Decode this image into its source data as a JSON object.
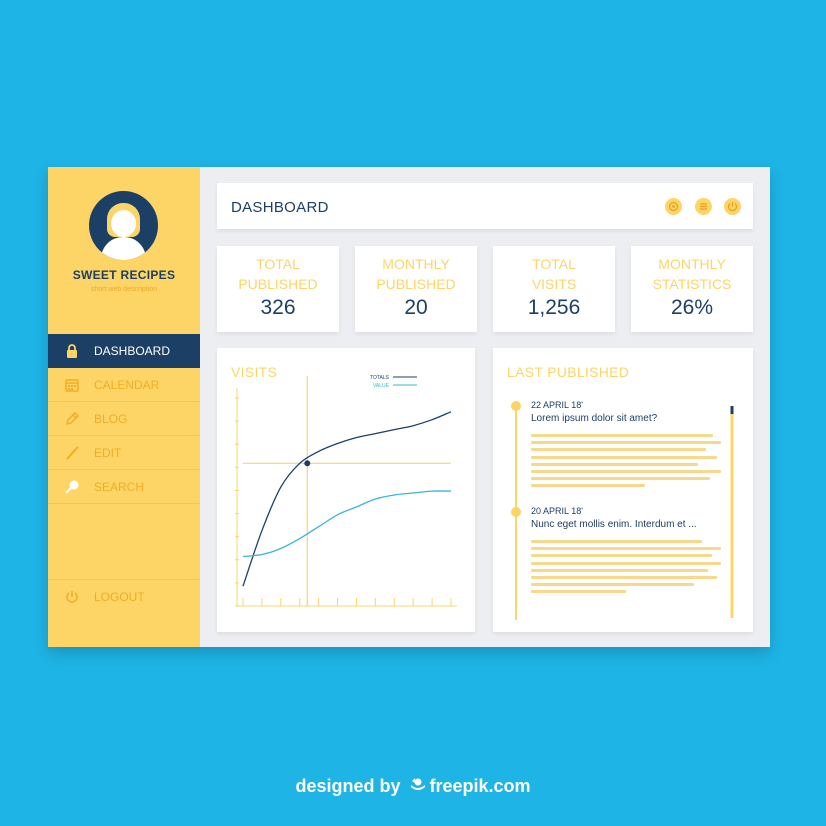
{
  "sidebar": {
    "brand": "SWEET RECIPES",
    "subtitle": "short web description",
    "nav": [
      {
        "label": "DASHBOARD",
        "icon": "lock-icon",
        "active": true
      },
      {
        "label": "CALENDAR",
        "icon": "calendar-icon",
        "active": false
      },
      {
        "label": "BLOG",
        "icon": "pencil-icon",
        "active": false
      },
      {
        "label": "EDIT",
        "icon": "brush-icon",
        "active": false
      },
      {
        "label": "SEARCH",
        "icon": "search-icon",
        "active": false
      }
    ],
    "logout": {
      "label": "LOGOUT",
      "icon": "power-icon"
    }
  },
  "header": {
    "title": "DASHBOARD",
    "icons": [
      "settings-icon",
      "menu-icon",
      "power-icon"
    ]
  },
  "stats": [
    {
      "label": [
        "TOTAL",
        "PUBLISHED"
      ],
      "value": "326"
    },
    {
      "label": [
        "MONTHLY",
        "PUBLISHED"
      ],
      "value": "20"
    },
    {
      "label": [
        "TOTAL",
        "VISITS"
      ],
      "value": "1,256"
    },
    {
      "label": [
        "MONTHLY",
        "STATISTICS"
      ],
      "value": "26%"
    }
  ],
  "visits": {
    "title": "VISITS",
    "legend": [
      {
        "name": "TOTALS",
        "color": "#1c3f66"
      },
      {
        "name": "VALUE",
        "color": "#3bb5d6"
      }
    ]
  },
  "last_published": {
    "title": "LAST PUBLISHED",
    "entries": [
      {
        "date": "22 APRIL 18'",
        "title": "Lorem ipsum dolor sit amet?"
      },
      {
        "date": "20 APRIL 18'",
        "title": "Nunc eget mollis enim. Interdum et ..."
      }
    ]
  },
  "chart_data": {
    "type": "line",
    "title": "VISITS",
    "x": [
      0,
      1,
      2,
      3,
      4,
      5,
      6,
      7,
      8,
      9,
      10,
      11
    ],
    "series": [
      {
        "name": "TOTALS",
        "values": [
          10,
          38,
          60,
          72,
          78,
          82,
          85,
          87,
          89,
          91,
          94,
          98
        ]
      },
      {
        "name": "VALUE",
        "values": [
          25,
          26,
          29,
          34,
          40,
          46,
          50,
          54,
          56,
          57,
          58,
          58
        ]
      }
    ],
    "ylim": [
      0,
      110
    ],
    "grid": false,
    "legend": "top-right",
    "crosshair": {
      "x": 3.4,
      "y": 72
    }
  },
  "colors": {
    "background": "#1eb4e6",
    "sidebar": "#fdd567",
    "navy": "#1c3f66",
    "accent": "#f0ad22",
    "teal": "#3bb5d6"
  },
  "credit": {
    "prefix": "designed by",
    "brand": "freepik.com",
    "icon": "freepik-logo-icon"
  }
}
